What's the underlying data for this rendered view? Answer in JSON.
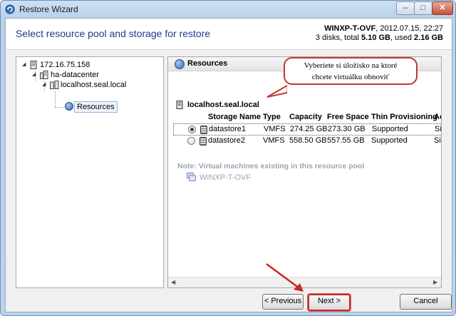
{
  "window": {
    "title": "Restore Wizard",
    "min_glyph": "–",
    "max_glyph": "□",
    "close_glyph": "✕"
  },
  "header": {
    "title": "Select resource pool and storage for restore",
    "vm_name": "WINXP-T-OVF",
    "vm_date": ", 2012.07.15,  22:27",
    "disks_prefix": "3 disks, total ",
    "total_size": "5.10 GB",
    "used_label": ", used ",
    "used_size": "2.16 GB"
  },
  "tree": {
    "host_ip": "172.16.75.158",
    "datacenter": "ha-datacenter",
    "host": "localhost.seal.local",
    "resources": "Resources"
  },
  "main": {
    "panel_title": "Resources",
    "host_label": "localhost.seal.local",
    "columns": [
      "Storage Name",
      "Type",
      "Capacity",
      "Free Space",
      "Thin Provisioning",
      "Ac"
    ],
    "rows": [
      {
        "name": "datastore1",
        "type": "VMFS",
        "capacity": "274.25 GB",
        "free": "273.30 GB",
        "thin": "Supported",
        "ac": "Sir",
        "selected": true
      },
      {
        "name": "datastore2",
        "type": "VMFS",
        "capacity": "558.50 GB",
        "free": "557.55 GB",
        "thin": "Supported",
        "ac": "Sir",
        "selected": false
      }
    ],
    "note": "Note: Virtual machines existing in this resource pool",
    "existing_vm": "WINXP-T-OVF"
  },
  "callout": {
    "line1": "Vyberiete si úložisko na ktoré",
    "line2": "chcete virtuálku obnoviť"
  },
  "buttons": {
    "previous": "< Previous",
    "next": "Next >",
    "cancel": "Cancel"
  },
  "colors": {
    "accent_title": "#1e3c8c",
    "annotation_red": "#c62828"
  }
}
